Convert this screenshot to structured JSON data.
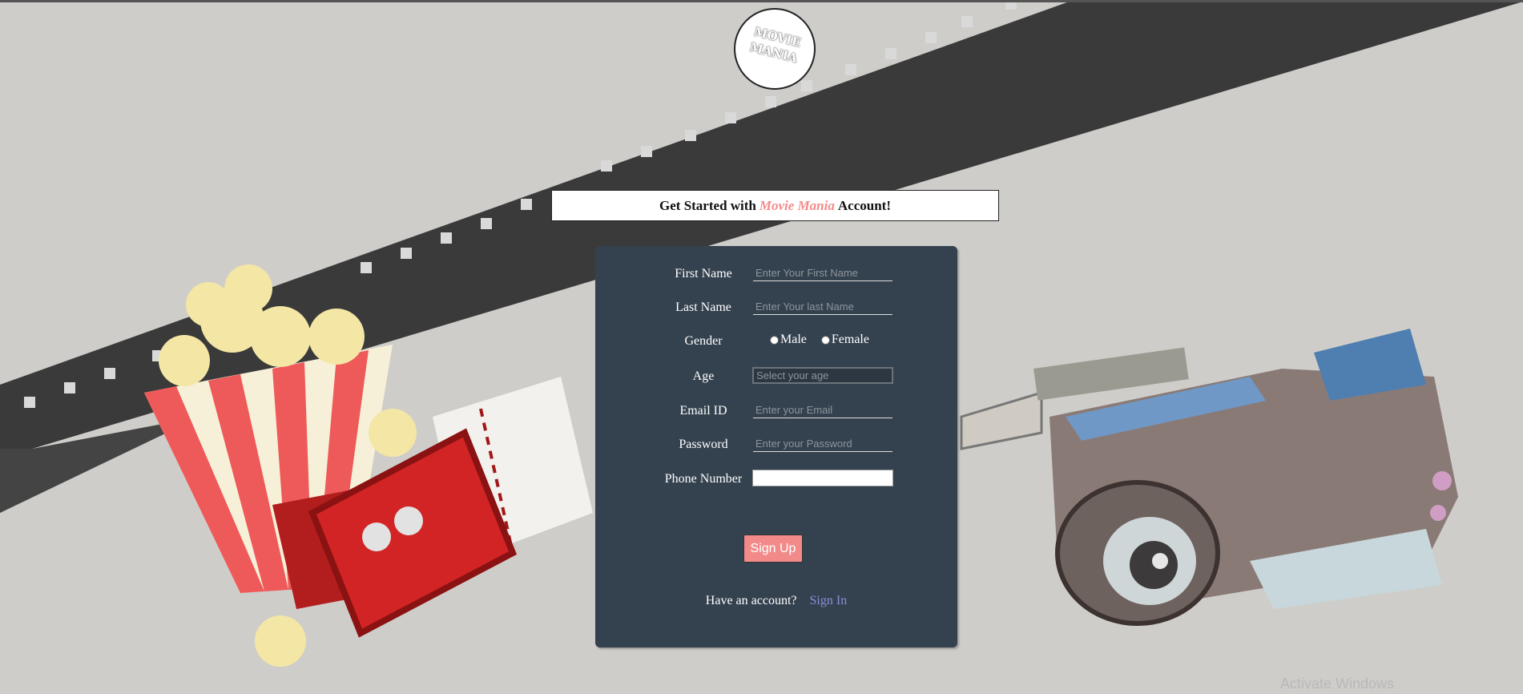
{
  "logo": {
    "line1": "MOVIE",
    "line2": "MANIA"
  },
  "banner": {
    "prefix": "Get Started with",
    "brand": "Movie Mania",
    "suffix": "Account!"
  },
  "form": {
    "first_name": {
      "label": "First Name",
      "placeholder": "Enter Your First Name"
    },
    "last_name": {
      "label": "Last Name",
      "placeholder": "Enter Your last Name"
    },
    "gender": {
      "label": "Gender",
      "options": [
        "Male",
        "Female"
      ]
    },
    "age": {
      "label": "Age",
      "placeholder": "Select your age"
    },
    "email": {
      "label": "Email ID",
      "placeholder": "Enter your Email"
    },
    "password": {
      "label": "Password",
      "placeholder": "Enter your Password"
    },
    "phone": {
      "label": "Phone Number",
      "value": ""
    },
    "submit_label": "Sign Up",
    "have_account": "Have an account?",
    "signin_label": "Sign In"
  },
  "watermark": "Activate Windows",
  "colors": {
    "panel": "#34424f",
    "accent": "#f28a8a",
    "link": "#8a8fd8"
  }
}
